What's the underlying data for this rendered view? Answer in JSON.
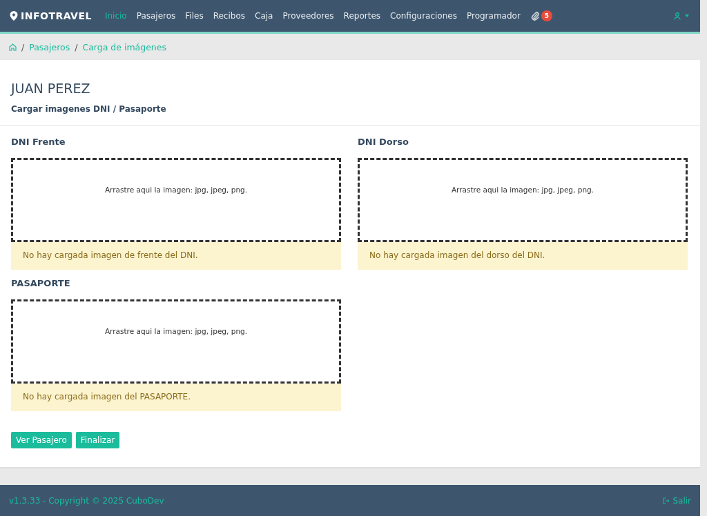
{
  "navbar": {
    "logo": "INFOTRAVEL",
    "items": [
      {
        "label": "Inicio",
        "selected": true
      },
      {
        "label": "Pasajeros",
        "selected": false
      },
      {
        "label": "Files",
        "selected": false
      },
      {
        "label": "Recibos",
        "selected": false
      },
      {
        "label": "Caja",
        "selected": false
      },
      {
        "label": "Proveedores",
        "selected": false
      },
      {
        "label": "Reportes",
        "selected": false
      },
      {
        "label": "Configuraciones",
        "selected": false
      },
      {
        "label": "Programador",
        "selected": false
      }
    ],
    "attachments_badge": "5"
  },
  "breadcrumb": [
    {
      "separator": "/",
      "label": "Pasajeros"
    },
    {
      "separator": "/",
      "label": "Carga de imágenes"
    }
  ],
  "header": {
    "title": "JUAN PEREZ",
    "subtitle": "Cargar imagenes DNI / Pasaporte"
  },
  "uploads": [
    {
      "label": "DNI Frente",
      "dropzone": "Arrastre aqui la imagen: jpg, jpeg, png.",
      "notice": "No hay cargada imagen de frente del DNI."
    },
    {
      "label": "DNI Dorso",
      "dropzone": "Arrastre aqui la imagen: jpg, jpeg, png.",
      "notice": "No hay cargada imagen del dorso del DNI."
    },
    {
      "label": "PASAPORTE",
      "dropzone": "Arrastre aqui la imagen: jpg, jpeg, png.",
      "notice": "No hay cargada imagen del PASAPORTE."
    }
  ],
  "buttons": [
    "Ver Pasajero",
    "Finalizar"
  ],
  "footer": {
    "copyright": "v1.3.33 - Copyright © 2025 CuboDev",
    "logout": "Salir"
  }
}
